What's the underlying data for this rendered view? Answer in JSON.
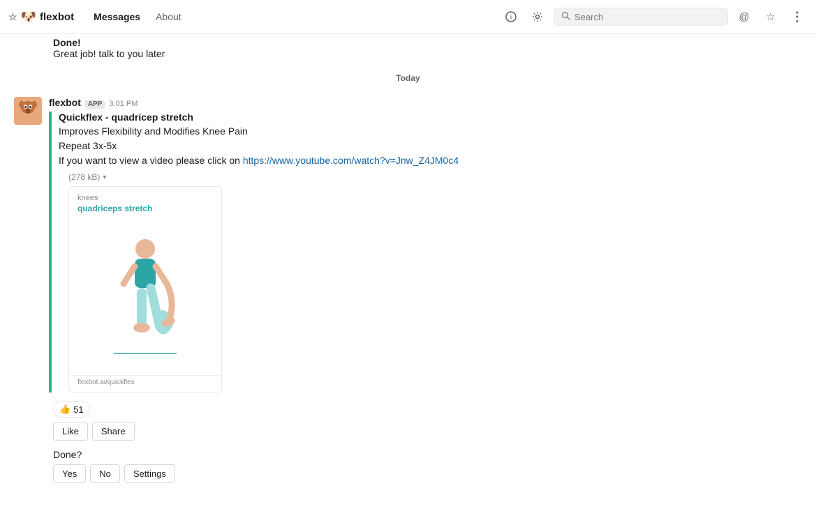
{
  "topbar": {
    "app_icon": "🐶",
    "app_title": "flexbot",
    "nav": {
      "messages_label": "Messages",
      "about_label": "About"
    },
    "search_placeholder": "Search",
    "info_icon": "ℹ",
    "settings_icon": "⚙",
    "mention_icon": "@",
    "star_icon": "☆",
    "more_icon": "⋮"
  },
  "chat": {
    "date_divider": "Today",
    "prev_done_label": "Done!",
    "prev_done_text": "Great job! talk to you later",
    "message": {
      "sender": "flexbot",
      "badge": "APP",
      "timestamp": "3:01 PM",
      "card_title": "Quickflex - quadricep stretch",
      "card_line1": "Improves Flexibility and Modifies Knee Pain",
      "card_line2": "Repeat 3x-5x",
      "card_line3_prefix": "If you want to view a video please click on ",
      "card_link_text": "https://www.youtube.com/watch?v=Jnw_Z4JM0c4",
      "card_link_url": "https://www.youtube.com/watch?v=Jnw_Z4JM0c4",
      "file_size": "(278 kB)",
      "image_label": "knees",
      "image_sublabel": "quadriceps stretch",
      "image_footer": "flexbot.ai/quickflex",
      "reaction_emoji": "👍",
      "reaction_count": "51",
      "like_btn": "Like",
      "share_btn": "Share",
      "done_question": "Done?",
      "yes_btn": "Yes",
      "no_btn": "No",
      "settings_btn": "Settings"
    }
  }
}
